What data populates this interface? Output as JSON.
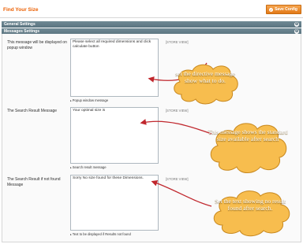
{
  "header": {
    "title": "Find Your Size",
    "save_label": "Save Config",
    "save_icon": "check-icon"
  },
  "sections": {
    "general": "General Settings",
    "messages": "Messages Settings",
    "toggle_glyph": "⊕"
  },
  "fields": [
    {
      "label": "This message will be displayed on popup window",
      "value": "Please select all required dimensions and click calculate button",
      "note": "Popup window message",
      "scope": "[STORE VIEW]"
    },
    {
      "label": "The Search Result Message",
      "value": "Your optimal size is",
      "note": "Search result message",
      "scope": "[STORE VIEW]"
    },
    {
      "label": "The Search Result if not found Message",
      "value": "Sorry No size found for these Dimensions.",
      "note": "Text to be displayed if Results not found",
      "scope": "[STORE VIEW]"
    }
  ],
  "callouts": [
    {
      "text": "set the directive message show what to do."
    },
    {
      "text": "This message shows the standard size available after search"
    },
    {
      "text": "Set the text showing no result found after search."
    }
  ],
  "colors": {
    "accent": "#eb5e00",
    "section_bar": "#5b7480",
    "cloud_fill": "#f7bd4e",
    "arrow": "#c0272d"
  }
}
